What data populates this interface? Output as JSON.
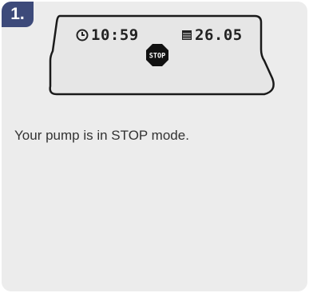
{
  "step": {
    "number": "1."
  },
  "display": {
    "time": "10:59",
    "reservoir": "26.05",
    "stop_label": "STOP",
    "clock_icon": "clock-icon",
    "reservoir_icon": "reservoir-icon"
  },
  "message": {
    "text": "Your pump is in STOP mode."
  },
  "colors": {
    "badge": "#3d4a7a",
    "card_background": "#ececec",
    "display_background": "#e6e6e6"
  }
}
